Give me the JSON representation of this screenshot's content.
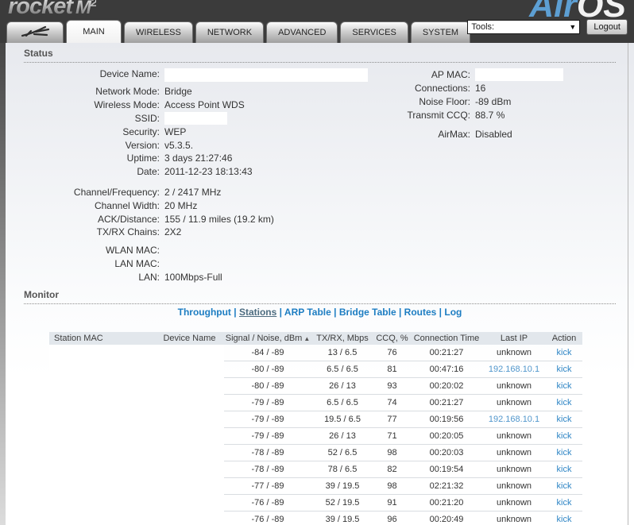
{
  "header": {
    "logo_text": "rocket",
    "logo_model": "M",
    "logo_model_sup": "2",
    "brand_air": "Air",
    "brand_os": "OS",
    "tabs": [
      {
        "label": "MAIN",
        "active": true
      },
      {
        "label": "WIRELESS",
        "active": false
      },
      {
        "label": "NETWORK",
        "active": false
      },
      {
        "label": "ADVANCED",
        "active": false
      },
      {
        "label": "SERVICES",
        "active": false
      },
      {
        "label": "SYSTEM",
        "active": false
      }
    ],
    "tools_label": "Tools:",
    "logout_label": "Logout",
    "colors": {
      "header_bg": "#3b3b3b",
      "brand_blue": "#5d9fd3",
      "link_blue": "#1d7dc2"
    }
  },
  "status": {
    "title": "Status",
    "left_fields": [
      {
        "label": "Device Name:",
        "value": "",
        "redacted_w": 256
      },
      {
        "label": "Network Mode:",
        "value": "Bridge"
      },
      {
        "label": "Wireless Mode:",
        "value": "Access Point WDS"
      },
      {
        "label": "SSID:",
        "value": "",
        "redacted_w": 79
      },
      {
        "label": "Security:",
        "value": "WEP"
      },
      {
        "label": "Version:",
        "value": "v5.3.5."
      },
      {
        "label": "Uptime:",
        "value": "3 days 21:27:46"
      },
      {
        "label": "Date:",
        "value": "2011-12-23 18:13:43"
      },
      {
        "spacer": 9
      },
      {
        "label": "Channel/Frequency:",
        "value": "2 / 2417 MHz"
      },
      {
        "label": "Channel Width:",
        "value": "20 MHz"
      },
      {
        "label": "ACK/Distance:",
        "value": "155 / 11.9 miles (19.2 km)"
      },
      {
        "label": "TX/RX Chains:",
        "value": "2X2"
      },
      {
        "spacer": 6
      },
      {
        "label": "WLAN MAC:",
        "value": ""
      },
      {
        "label": "LAN MAC:",
        "value": ""
      },
      {
        "label": "LAN:",
        "value": "100Mbps-Full"
      }
    ],
    "right_fields": [
      {
        "label": "AP MAC:",
        "value": "",
        "redacted_w": 111
      },
      {
        "label": "Connections:",
        "value": "16"
      },
      {
        "label": "Noise Floor:",
        "value": "-89 dBm"
      },
      {
        "label": "Transmit CCQ:",
        "value": "88.7 %"
      },
      {
        "spacer": 7
      },
      {
        "label": "AirMax:",
        "value": "Disabled"
      }
    ]
  },
  "monitor": {
    "title": "Monitor",
    "links": [
      {
        "label": "Throughput",
        "active": false
      },
      {
        "label": "Stations",
        "active": true
      },
      {
        "label": "ARP Table",
        "active": false
      },
      {
        "label": "Bridge Table",
        "active": false
      },
      {
        "label": "Routes",
        "active": false
      },
      {
        "label": "Log",
        "active": false
      }
    ]
  },
  "stations_table": {
    "columns": [
      {
        "label": "Station MAC"
      },
      {
        "label": "Device Name"
      },
      {
        "label": "Signal / Noise, dBm",
        "sort": "asc"
      },
      {
        "label": "TX/RX, Mbps"
      },
      {
        "label": "CCQ, %"
      },
      {
        "label": "Connection Time"
      },
      {
        "label": "Last IP"
      },
      {
        "label": "Action"
      }
    ],
    "rows": [
      {
        "station_mac": "",
        "device_name": "",
        "signal_noise": "-84 / -89",
        "txrx": "13 / 6.5",
        "ccq": "76",
        "time": "00:21:27",
        "last_ip": "unknown",
        "action": "kick"
      },
      {
        "station_mac": "",
        "device_name": "",
        "signal_noise": "-80 / -89",
        "txrx": "6.5 / 6.5",
        "ccq": "81",
        "time": "00:47:16",
        "last_ip": "192.168.10.1",
        "action": "kick"
      },
      {
        "station_mac": "",
        "device_name": "",
        "signal_noise": "-80 / -89",
        "txrx": "26 / 13",
        "ccq": "93",
        "time": "00:20:02",
        "last_ip": "unknown",
        "action": "kick"
      },
      {
        "station_mac": "",
        "device_name": "",
        "signal_noise": "-79 / -89",
        "txrx": "6.5 / 6.5",
        "ccq": "74",
        "time": "00:21:27",
        "last_ip": "unknown",
        "action": "kick"
      },
      {
        "station_mac": "",
        "device_name": "",
        "signal_noise": "-79 / -89",
        "txrx": "19.5 / 6.5",
        "ccq": "77",
        "time": "00:19:56",
        "last_ip": "192.168.10.1",
        "action": "kick"
      },
      {
        "station_mac": "",
        "device_name": "",
        "signal_noise": "-79 / -89",
        "txrx": "26 / 13",
        "ccq": "71",
        "time": "00:20:05",
        "last_ip": "unknown",
        "action": "kick"
      },
      {
        "station_mac": "",
        "device_name": "",
        "signal_noise": "-78 / -89",
        "txrx": "52 / 6.5",
        "ccq": "98",
        "time": "00:20:03",
        "last_ip": "unknown",
        "action": "kick"
      },
      {
        "station_mac": "",
        "device_name": "",
        "signal_noise": "-78 / -89",
        "txrx": "78 / 6.5",
        "ccq": "82",
        "time": "00:19:54",
        "last_ip": "unknown",
        "action": "kick"
      },
      {
        "station_mac": "",
        "device_name": "",
        "signal_noise": "-77 / -89",
        "txrx": "39 / 19.5",
        "ccq": "98",
        "time": "02:21:32",
        "last_ip": "unknown",
        "action": "kick"
      },
      {
        "station_mac": "",
        "device_name": "",
        "signal_noise": "-76 / -89",
        "txrx": "52 / 19.5",
        "ccq": "91",
        "time": "00:21:20",
        "last_ip": "unknown",
        "action": "kick"
      },
      {
        "station_mac": "",
        "device_name": "",
        "signal_noise": "-76 / -89",
        "txrx": "39 / 19.5",
        "ccq": "96",
        "time": "00:20:49",
        "last_ip": "unknown",
        "action": "kick"
      }
    ]
  }
}
